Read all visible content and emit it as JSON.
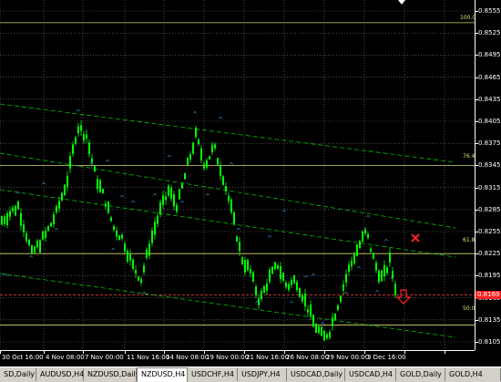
{
  "window": {
    "symbol": "NZDUSD",
    "timeframe": "H4"
  },
  "price_axis": {
    "labels": [
      "0.8555",
      "0.8525",
      "0.8495",
      "0.8465",
      "0.8435",
      "0.8405",
      "0.8375",
      "0.8345",
      "0.8315",
      "0.8285",
      "0.8255",
      "0.8225",
      "0.8195",
      "0.8165",
      "0.8135",
      "0.8105"
    ],
    "values": [
      0.8555,
      0.8525,
      0.8495,
      0.8465,
      0.8435,
      0.8405,
      0.8375,
      0.8345,
      0.8315,
      0.8285,
      0.8255,
      0.8225,
      0.8195,
      0.8165,
      0.8135,
      0.8105
    ],
    "current_price": "0.8169",
    "current_price_value": 0.8169
  },
  "time_axis": {
    "labels": [
      "30 Oct 16:00",
      "4 Nov 08:00",
      "7 Nov 00:00",
      "11 Nov 16:00",
      "14 Nov 08:00",
      "19 Nov 00:00",
      "21 Nov 16:00",
      "26 Nov 08:00",
      "29 Nov 00:00",
      "3 Dec 16:00"
    ]
  },
  "fibonacci": {
    "levels": [
      {
        "label": "100.0",
        "price": 0.8539
      },
      {
        "label": "76.4",
        "price": 0.8345
      },
      {
        "label": "61.8",
        "price": 0.8225
      },
      {
        "label": "50.0",
        "price": 0.8128
      }
    ]
  },
  "current_price_line_color": "#ff4040",
  "fibo_color": "#d6d66a",
  "candle_color": "#00ff00",
  "channel_color": "#00c000",
  "signal_up_color": "#3fa9ff",
  "signal_down_color": "#3fa9ff",
  "markers": {
    "cross_icon": "red-x-icon",
    "arrow_icon": "red-down-arrow-icon"
  },
  "tabs": [
    {
      "label": "SD,Daily",
      "active": false
    },
    {
      "label": "AUDUSD,H4",
      "active": false
    },
    {
      "label": "NZDUSD,Daily",
      "active": false
    },
    {
      "label": "NZDUSD,H4",
      "active": true
    },
    {
      "label": "USDCHF,H4",
      "active": false
    },
    {
      "label": "USDJPY,H4",
      "active": false
    },
    {
      "label": "USDCAD,Daily",
      "active": false
    },
    {
      "label": "USDCAD,H4",
      "active": false
    },
    {
      "label": "GOLD,Daily",
      "active": false
    },
    {
      "label": "GOLD,H4",
      "active": false
    }
  ]
}
